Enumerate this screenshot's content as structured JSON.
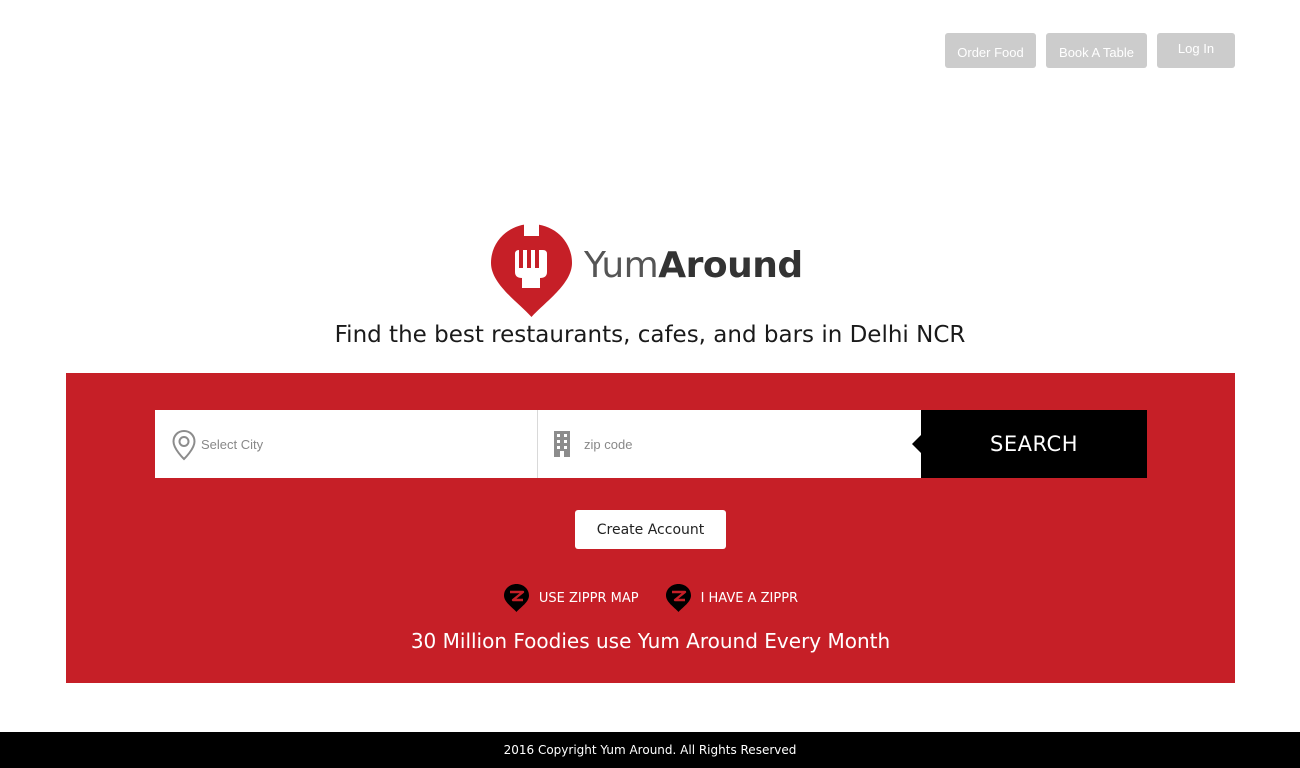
{
  "nav": {
    "order_food": "Order Food",
    "book_table": "Book A Table",
    "login": "Log In"
  },
  "logo": {
    "text_light": "Yum",
    "text_bold": "Around",
    "icon": "fork-pin-icon",
    "color": "#c61f27"
  },
  "tagline": "Find the best restaurants, cafes, and bars in Delhi NCR",
  "search": {
    "city_placeholder": "Select City",
    "city_icon": "map-pin-icon",
    "zip_placeholder": "zip code",
    "zip_icon": "building-icon",
    "button_label": "SEARCH"
  },
  "create_account": "Create Account",
  "zippr": {
    "use_map": "USE ZIPPR MAP",
    "have_zippr": "I HAVE A ZIPPR",
    "icon": "zippr-icon"
  },
  "foodies_text": "30 Million Foodies use Yum Around Every Month",
  "footer": "2016 Copyright Yum Around. All Rights Reserved",
  "colors": {
    "brand_red": "#c61f27",
    "nav_button": "#cccccc",
    "search_button": "#000000",
    "footer_bg": "#000000"
  }
}
